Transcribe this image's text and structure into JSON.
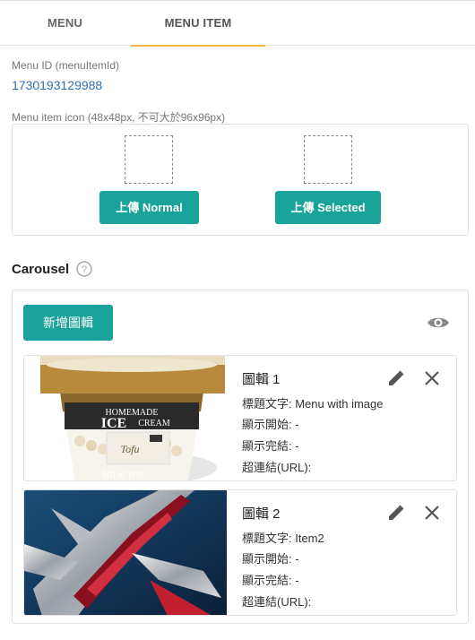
{
  "tabs": [
    {
      "label": "MENU"
    },
    {
      "label": "MENU ITEM"
    }
  ],
  "menu_id": {
    "label": "Menu ID (menuItemId)",
    "value": "1730193129988"
  },
  "menu_icon": {
    "label": "Menu item icon (48x48px, 不可大於96x96px)",
    "upload_normal": "上傳 Normal",
    "upload_selected": "上傳 Selected"
  },
  "carousel": {
    "title": "Carousel",
    "add_button": "新增圖輯",
    "items": [
      {
        "title": "圖輯 1",
        "caption": "標題文字: Menu with image",
        "start": "顯示開始: -",
        "end": "顯示完結: -",
        "url": "超連結(URL):",
        "image": {
          "icon": "ice-cream-cup-image",
          "text_main": "ICE",
          "text_top": "HOMEMADE",
          "text_sub": "CREAM",
          "flavor": "Tofu",
          "base_text": "MILK TOP"
        }
      },
      {
        "title": "圖輯 2",
        "caption": "標題文字: Item2",
        "start": "顯示開始: -",
        "end": "顯示完結: -",
        "url": "超連結(URL):",
        "image": {
          "icon": "metallic-red-artwork-image"
        }
      }
    ]
  },
  "colors": {
    "accent": "#1aa39a",
    "tab_underline": "#f2b740",
    "link": "#2f6fb3"
  }
}
